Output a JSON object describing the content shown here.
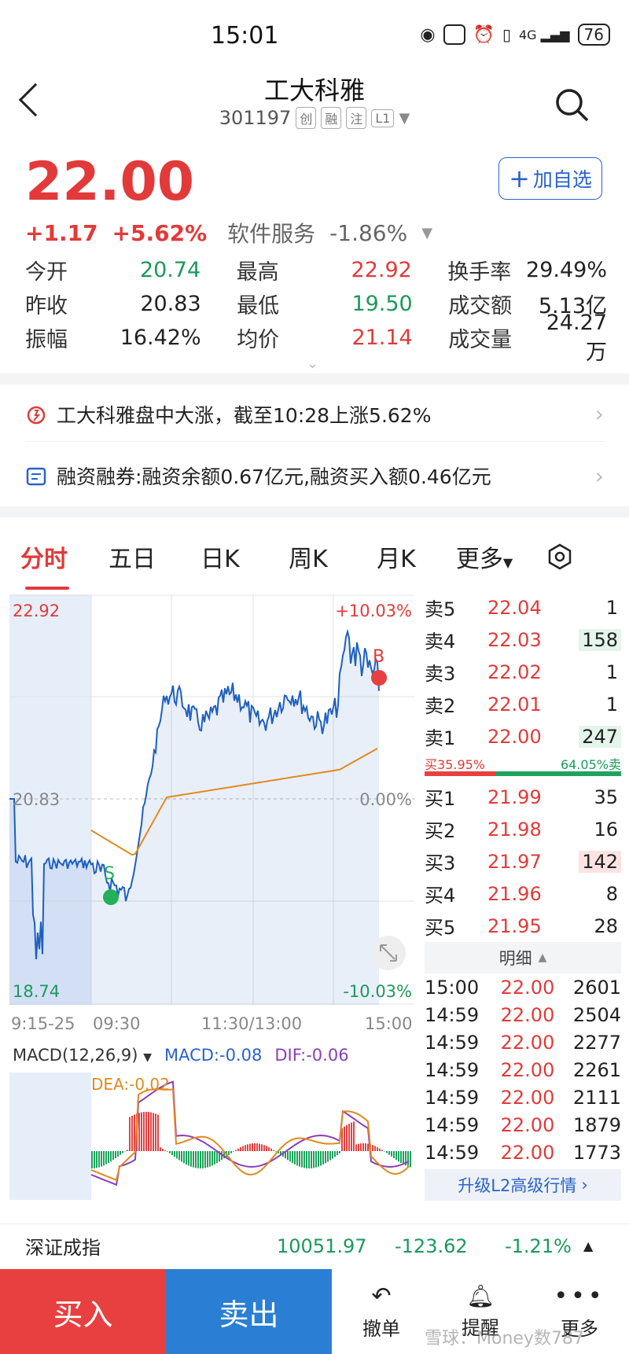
{
  "status": {
    "time": "15:01",
    "battery": "76"
  },
  "header": {
    "title": "工大科雅",
    "code": "301197",
    "tags": [
      "创",
      "融",
      "注",
      "L1"
    ]
  },
  "price": {
    "current": "22.00",
    "change": "+1.17",
    "change_pct": "+5.62%",
    "sector": "软件服务",
    "sector_pct": "-1.86%"
  },
  "add_watch": "加自选",
  "quotes": [
    [
      {
        "label": "今开",
        "value": "20.74",
        "color": "green"
      },
      {
        "label": "最高",
        "value": "22.92",
        "color": "red"
      },
      {
        "label": "换手率",
        "value": "29.49%",
        "color": "black"
      }
    ],
    [
      {
        "label": "昨收",
        "value": "20.83",
        "color": "black"
      },
      {
        "label": "最低",
        "value": "19.50",
        "color": "green"
      },
      {
        "label": "成交额",
        "value": "5.13亿",
        "color": "black"
      }
    ],
    [
      {
        "label": "振幅",
        "value": "16.42%",
        "color": "black"
      },
      {
        "label": "均价",
        "value": "21.14",
        "color": "red"
      },
      {
        "label": "成交量",
        "value": "24.27万",
        "color": "black"
      }
    ]
  ],
  "news": [
    {
      "icon": "alarm-icon",
      "text": "工大科雅盘中大涨，截至10:28上涨5.62%"
    },
    {
      "icon": "calendar-icon",
      "text": "融资融券:融资余额0.67亿元,融资买入额0.46亿元"
    }
  ],
  "tabs": [
    "分时",
    "五日",
    "日K",
    "周K",
    "月K",
    "更多"
  ],
  "chart_labels": {
    "high": "22.92",
    "low": "18.74",
    "mid": "20.83",
    "pct_high": "+10.03%",
    "pct_mid": "0.00%",
    "pct_low": "-10.03%",
    "time_ticks": [
      "9:15-25",
      "09:30",
      "11:30/13:00",
      "15:00"
    ],
    "marker_s": "S",
    "marker_b": "B"
  },
  "macd": {
    "name": "MACD(12,26,9)",
    "macd": "MACD:-0.08",
    "dif": "DIF:-0.06",
    "dea": "DEA:-0.02"
  },
  "order_book": {
    "asks": [
      {
        "label": "卖5",
        "price": "22.04",
        "vol": "1"
      },
      {
        "label": "卖4",
        "price": "22.03",
        "vol": "158"
      },
      {
        "label": "卖3",
        "price": "22.02",
        "vol": "1"
      },
      {
        "label": "卖2",
        "price": "22.01",
        "vol": "1"
      },
      {
        "label": "卖1",
        "price": "22.00",
        "vol": "247"
      }
    ],
    "ratio_buy": "买35.95%",
    "ratio_sell": "64.05%卖",
    "bids": [
      {
        "label": "买1",
        "price": "21.99",
        "vol": "35"
      },
      {
        "label": "买2",
        "price": "21.98",
        "vol": "16"
      },
      {
        "label": "买3",
        "price": "21.97",
        "vol": "142"
      },
      {
        "label": "买4",
        "price": "21.96",
        "vol": "8"
      },
      {
        "label": "买5",
        "price": "21.95",
        "vol": "28"
      }
    ],
    "detail_title": "明细",
    "trades": [
      {
        "t": "15:00",
        "p": "22.00",
        "v": "2601"
      },
      {
        "t": "14:59",
        "p": "22.00",
        "v": "2504"
      },
      {
        "t": "14:59",
        "p": "22.00",
        "v": "2277"
      },
      {
        "t": "14:59",
        "p": "22.00",
        "v": "2261"
      },
      {
        "t": "14:59",
        "p": "22.00",
        "v": "2111"
      },
      {
        "t": "14:59",
        "p": "22.00",
        "v": "1879"
      },
      {
        "t": "14:59",
        "p": "22.00",
        "v": "1773"
      }
    ],
    "l2": "升级L2高级行情"
  },
  "index": {
    "name": "深证成指",
    "value": "10051.97",
    "change": "-123.62",
    "pct": "-1.21%"
  },
  "bottom": {
    "buy": "买入",
    "sell": "卖出",
    "cancel": "撤单",
    "remind": "提醒",
    "more": "更多"
  },
  "watermark": "雪球：Money数787",
  "colors": {
    "up": "#e23a3a",
    "down": "#1a9a5a",
    "accent": "#2a63c9"
  }
}
